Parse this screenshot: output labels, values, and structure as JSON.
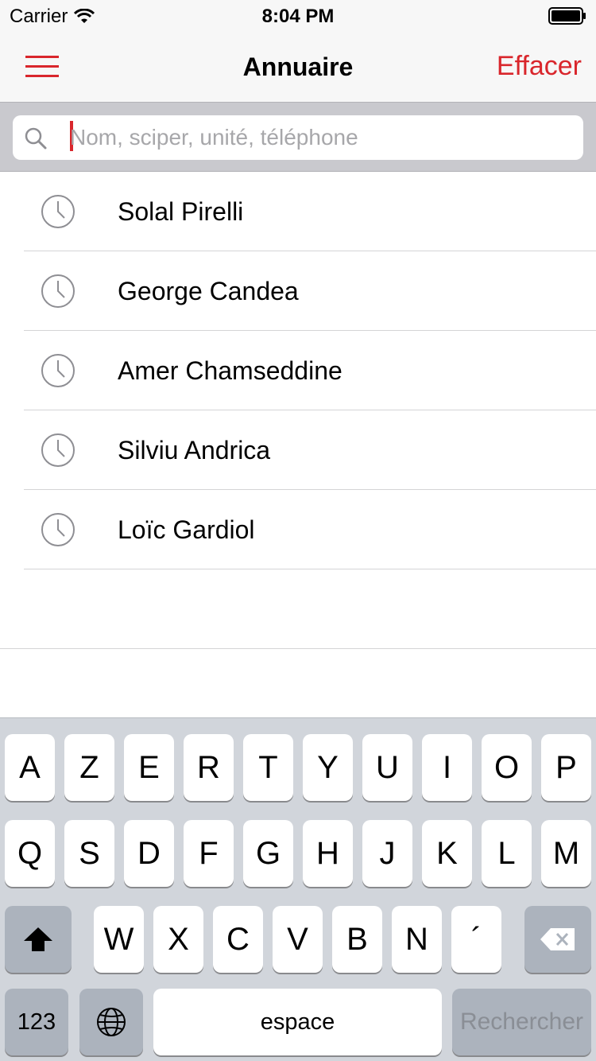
{
  "status_bar": {
    "carrier": "Carrier",
    "time": "8:04 PM"
  },
  "nav": {
    "menu_icon": "hamburger-menu-icon",
    "title": "Annuaire",
    "action_label": "Effacer",
    "accent_color": "#d9262c"
  },
  "search": {
    "placeholder": "Nom, sciper, unité, téléphone",
    "value": ""
  },
  "recent_items": [
    {
      "label": "Solal Pirelli",
      "icon": "clock-icon"
    },
    {
      "label": "George Candea",
      "icon": "clock-icon"
    },
    {
      "label": "Amer Chamseddine",
      "icon": "clock-icon"
    },
    {
      "label": "Silviu Andrica",
      "icon": "clock-icon"
    },
    {
      "label": "Loïc Gardiol",
      "icon": "clock-icon"
    }
  ],
  "keyboard": {
    "row1": [
      "A",
      "Z",
      "E",
      "R",
      "T",
      "Y",
      "U",
      "I",
      "O",
      "P"
    ],
    "row2": [
      "Q",
      "S",
      "D",
      "F",
      "G",
      "H",
      "J",
      "K",
      "L",
      "M"
    ],
    "row3": [
      "W",
      "X",
      "C",
      "V",
      "B",
      "N",
      "´"
    ],
    "numbers_key": "123",
    "space_key": "espace",
    "return_key": "Rechercher"
  }
}
